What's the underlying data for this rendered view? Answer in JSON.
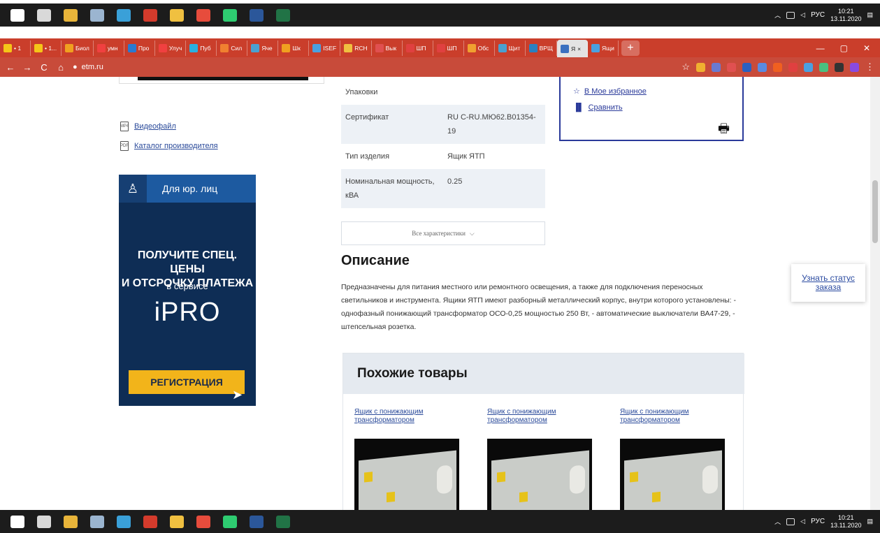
{
  "taskbar": {
    "time": "10:21",
    "date": "13.11.2020",
    "lang": "РУС",
    "apps": [
      {
        "icon": "start-icon",
        "color": "#ffffff"
      },
      {
        "icon": "task-view-icon",
        "color": "#d9d9d9"
      },
      {
        "icon": "file-explorer-icon",
        "color": "#e8b43a"
      },
      {
        "icon": "calculator-icon",
        "color": "#9bb5d0"
      },
      {
        "icon": "telegram-icon",
        "color": "#3aa0d8"
      },
      {
        "icon": "acrobat-icon",
        "color": "#d43b2c"
      },
      {
        "icon": "folder-icon",
        "color": "#f0c040"
      },
      {
        "icon": "chrome-icon",
        "color": "#e74c3c"
      },
      {
        "icon": "whatsapp-icon",
        "color": "#2ecc71"
      },
      {
        "icon": "word-icon",
        "color": "#2b579a"
      },
      {
        "icon": "excel-icon",
        "color": "#217346"
      }
    ]
  },
  "browser": {
    "tabs": [
      {
        "label": "• 1",
        "color": "#f5c518"
      },
      {
        "label": "• 1...",
        "color": "#f5c518"
      },
      {
        "label": "Биол",
        "color": "#f0a020"
      },
      {
        "label": "умн",
        "color": "#f04040"
      },
      {
        "label": "Про",
        "color": "#2a7ad0"
      },
      {
        "label": "Улуч",
        "color": "#f04040"
      },
      {
        "label": "Пуб",
        "color": "#2ab0e0"
      },
      {
        "label": "Сил",
        "color": "#f08030"
      },
      {
        "label": "Яче",
        "color": "#4aa0d0"
      },
      {
        "label": "Шк",
        "color": "#f0a020"
      },
      {
        "label": "ISEF",
        "color": "#4aa0e0"
      },
      {
        "label": "RCH",
        "color": "#f0c040"
      },
      {
        "label": "Вык",
        "color": "#e05050"
      },
      {
        "label": "ШП",
        "color": "#e04040"
      },
      {
        "label": "ШП",
        "color": "#e04040"
      },
      {
        "label": "Обс",
        "color": "#f0a030"
      },
      {
        "label": "Щит",
        "color": "#4aa0d0"
      },
      {
        "label": "ВРЩ",
        "color": "#2a80c0"
      },
      {
        "label": "Я",
        "color": "#3a70c0"
      },
      {
        "label": "Ящи",
        "color": "#4aa0e0"
      }
    ],
    "active_tab_index": 18,
    "new_tab": "+",
    "url": "etm.ru",
    "extensions": [
      "#f0b030",
      "#6a7ad0",
      "#e05050",
      "#2a60c0",
      "#5a8ae0",
      "#f06020",
      "#e04040",
      "#4aa0e0",
      "#4ac080",
      "#333333",
      "#8a4ae0"
    ]
  },
  "left": {
    "video_link": "Видеофайл",
    "catalog_link": "Каталог производителя",
    "banner": {
      "head_label": "Для юр. лиц",
      "promo_line1": "ПОЛУЧИТЕ СПЕЦ. ЦЕНЫ",
      "promo_line2": "И ОТСРОЧКУ ПЛАТЕЖА",
      "service": "в сервисе",
      "logo": "iPRO",
      "register": "РЕГИСТРАЦИЯ"
    }
  },
  "spec": {
    "rows": [
      {
        "k": "Упаковки",
        "v": ""
      },
      {
        "k": "Сертификат",
        "v": "RU C-RU.МЮ62.В01354-19"
      },
      {
        "k": "Тип изделия",
        "v": "Ящик ЯТП"
      },
      {
        "k": "Номинальная мощность, кВА",
        "v": "0.25"
      }
    ],
    "all_chars": "Все характеристики"
  },
  "actions": {
    "favorites": "В Мое избранное",
    "compare": "Сравнить"
  },
  "description": {
    "title": "Описание",
    "text": "Предназначены для питания местного или ремонтного освещения, а также для подключения переносных светильников и инструмента. Ящики ЯТП имеют разборный металлический корпус, внутри которого установлены: - однофазный понижающий трансформатор ОСО-0,25 мощностью 250 Вт, - автоматические выключатели ВА47-29, - штепсельная розетка."
  },
  "similar": {
    "title": "Похожие товары",
    "items": [
      {
        "name": "Ящик с понижающим трансформатором"
      },
      {
        "name": "Ящик с понижающим трансформатором"
      },
      {
        "name": "Ящик с понижающим трансформатором"
      }
    ]
  },
  "status_widget": "Узнать статус заказа"
}
